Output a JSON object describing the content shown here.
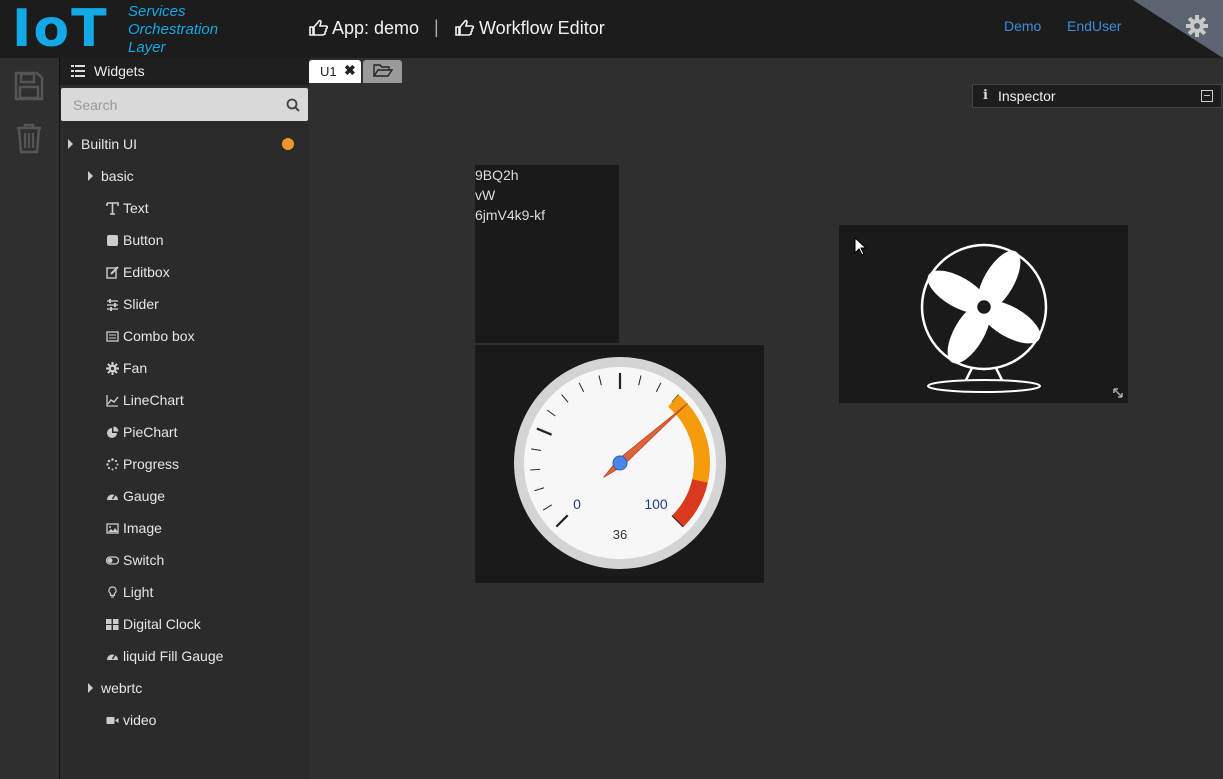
{
  "header": {
    "logo_iot": "IoT",
    "logo_lines": [
      "Services",
      "Orchestration",
      "Layer"
    ],
    "app_crumb": "App: demo",
    "separator": "|",
    "editor_crumb": "Workflow Editor",
    "links": [
      "Demo",
      "EndUser"
    ]
  },
  "sidebar": {
    "title": "Widgets",
    "search_placeholder": "Search",
    "tree": {
      "root": "Builtin UI",
      "groups": [
        {
          "label": "basic",
          "items": [
            {
              "label": "Text",
              "icon": "text-icon"
            },
            {
              "label": "Button",
              "icon": "button-icon"
            },
            {
              "label": "Editbox",
              "icon": "edit-icon"
            },
            {
              "label": "Slider",
              "icon": "sliders-icon"
            },
            {
              "label": "Combo box",
              "icon": "list-icon"
            },
            {
              "label": "Fan",
              "icon": "fan-gear-icon"
            },
            {
              "label": "LineChart",
              "icon": "line-chart-icon"
            },
            {
              "label": "PieChart",
              "icon": "pie-chart-icon"
            },
            {
              "label": "Progress",
              "icon": "spinner-icon"
            },
            {
              "label": "Gauge",
              "icon": "dashboard-icon"
            },
            {
              "label": "Image",
              "icon": "picture-icon"
            },
            {
              "label": "Switch",
              "icon": "toggle-icon"
            },
            {
              "label": "Light",
              "icon": "lightbulb-icon"
            },
            {
              "label": "Digital Clock",
              "icon": "grid-icon"
            },
            {
              "label": "liquid Fill Gauge",
              "icon": "dashboard-icon"
            }
          ]
        },
        {
          "label": "webrtc",
          "items": [
            {
              "label": "video",
              "icon": "video-icon"
            }
          ]
        }
      ]
    },
    "accent_dot_color": "#f0962a"
  },
  "tabs": {
    "active": "U1",
    "close_glyph": "✖"
  },
  "inspector": {
    "title": "Inspector",
    "info_glyph": "i"
  },
  "text_widget": {
    "lines": [
      "9BQ2h",
      "vW",
      "6jmV4k9-kf"
    ]
  },
  "gauge_widget": {
    "min_label": "0",
    "max_label": "100",
    "value": 36,
    "value_label": "36",
    "needle_color": "#e0623a",
    "zone_colors": [
      "#f59b0b",
      "#d9391c"
    ]
  },
  "colors": {
    "accent_blue": "#12a9e6",
    "link_blue": "#3b8fd9"
  }
}
